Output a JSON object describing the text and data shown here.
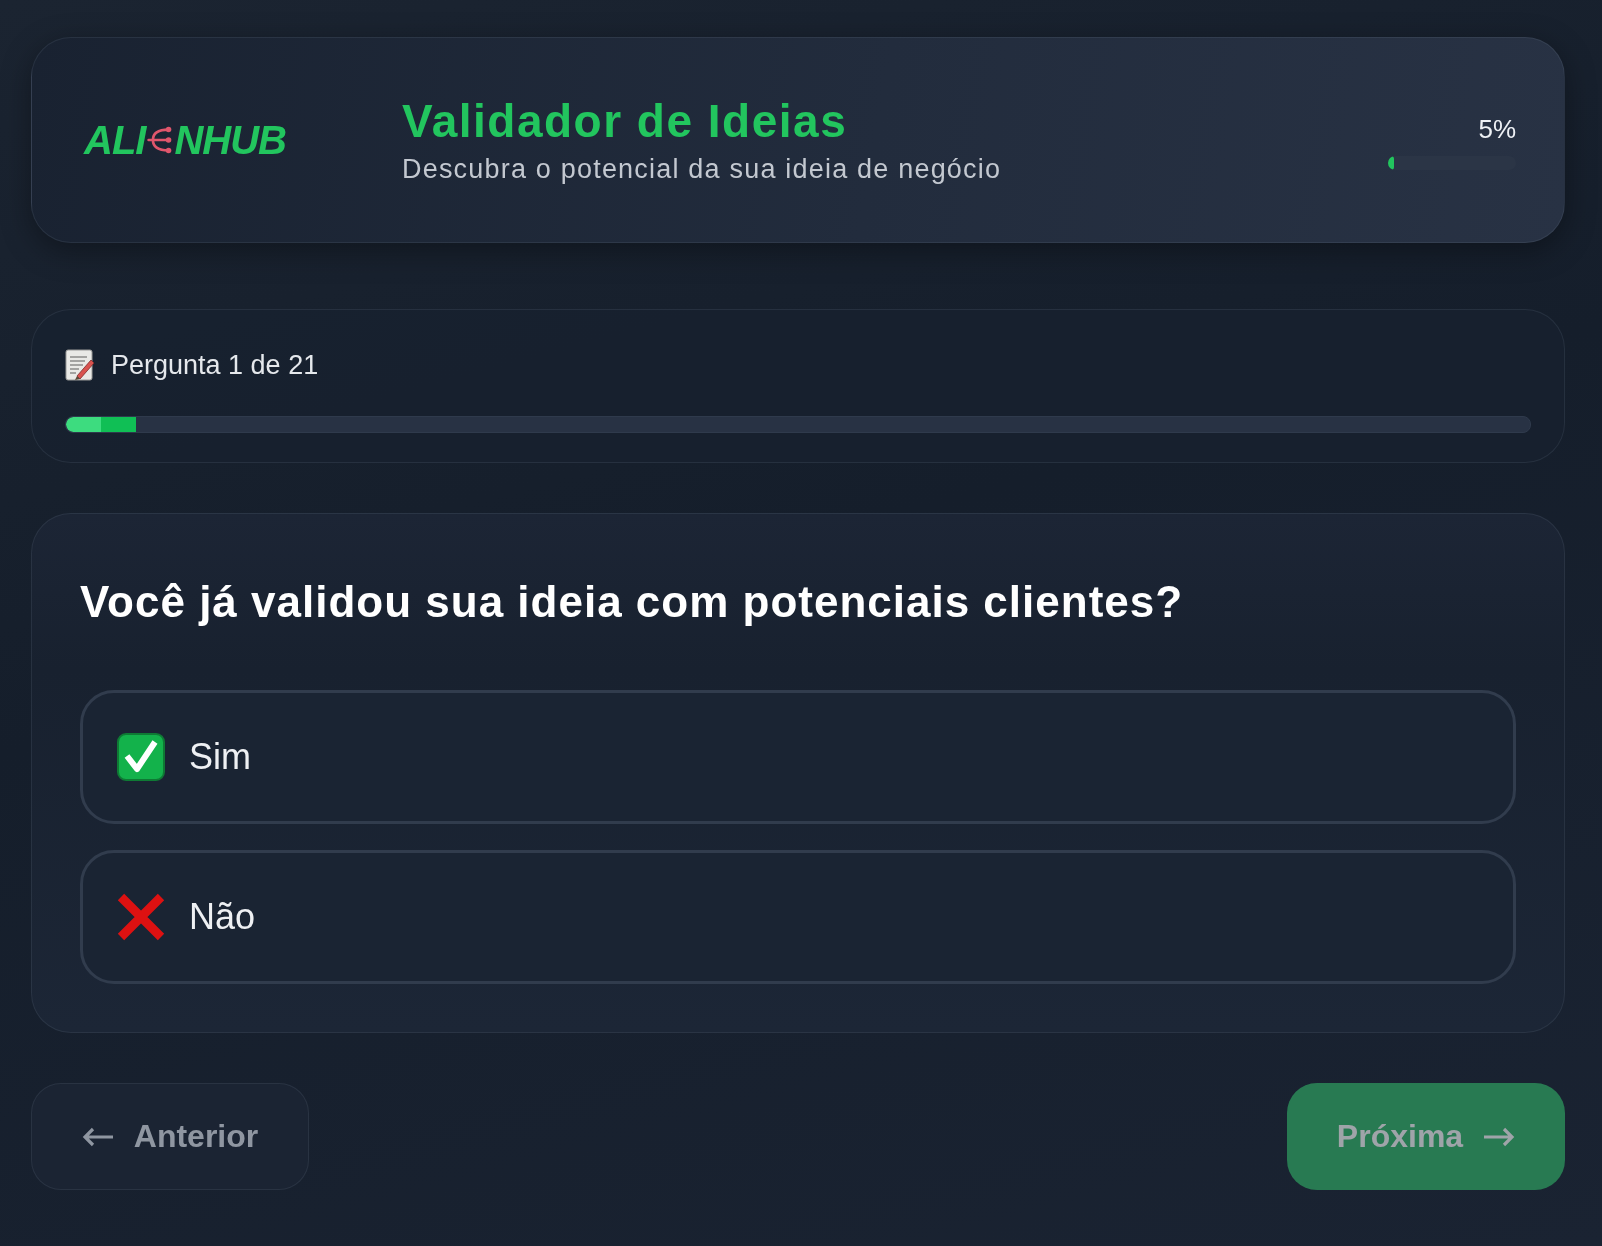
{
  "header": {
    "logo": {
      "text_before": "ALI",
      "text_after": "NHUB"
    },
    "title": "Validador de Ideias",
    "subtitle": "Descubra o potencial da sua ideia de negócio",
    "progress": {
      "reading": "5%",
      "level": 0.05
    }
  },
  "progress": {
    "label": "Pergunta 1 de 21",
    "level": 0.048
  },
  "question": {
    "text": "Você já validou sua ideia com potenciais clientes?",
    "options": [
      {
        "kind": "yes",
        "label": "Sim",
        "selected": false
      },
      {
        "kind": "no",
        "label": "Não",
        "selected": false
      }
    ]
  },
  "buttons": [
    {
      "kind": "back",
      "label": "Anterior",
      "disabled": true
    },
    {
      "kind": "next",
      "label": "Próxima",
      "disabled": true
    }
  ]
}
